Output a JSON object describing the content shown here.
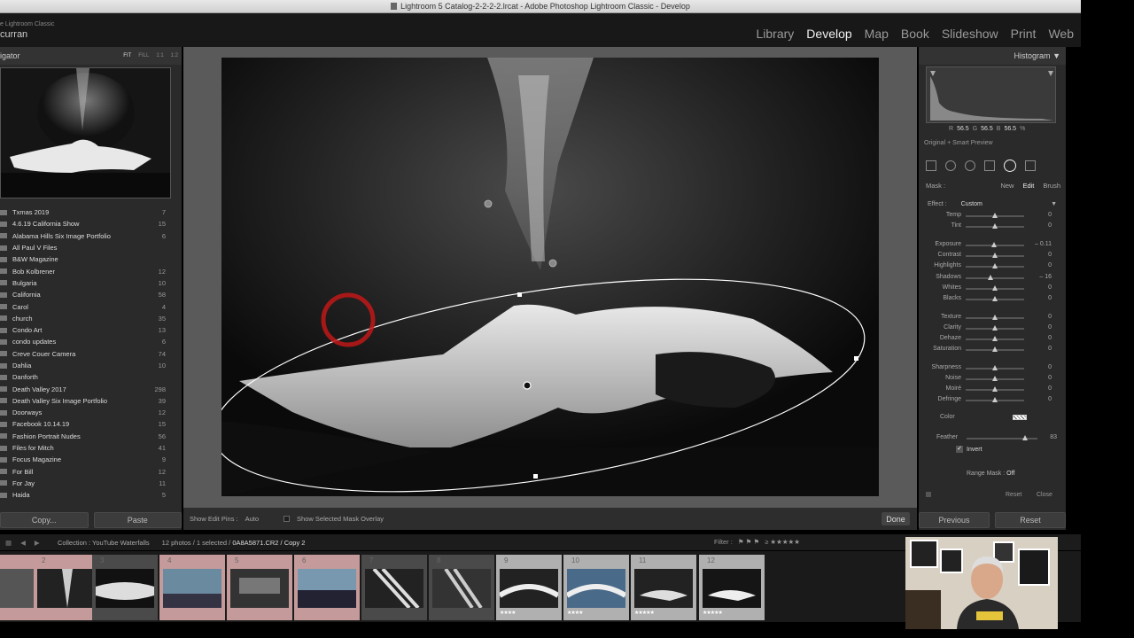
{
  "window": {
    "title": "Lightroom 5 Catalog-2-2-2-2.lrcat - Adobe Photoshop Lightroom Classic - Develop"
  },
  "brand": {
    "app": "e Lightroom Classic",
    "user": "curran"
  },
  "modules": [
    "Library",
    "Develop",
    "Map",
    "Book",
    "Slideshow",
    "Print",
    "Web"
  ],
  "navigator": {
    "title": "igator",
    "zoom": [
      "FIT",
      "FILL",
      "1:1",
      "1:2"
    ]
  },
  "collections": [
    {
      "name": "Txmas 2019",
      "count": "7"
    },
    {
      "name": "4.6.19 California Show",
      "count": "15"
    },
    {
      "name": "Alabama Hills Six Image Portfolio",
      "count": "6"
    },
    {
      "name": "All Paul V Files",
      "count": ""
    },
    {
      "name": "B&W Magazine",
      "count": ""
    },
    {
      "name": "Bob Kolbrener",
      "count": "12"
    },
    {
      "name": "Bulgaria",
      "count": "10"
    },
    {
      "name": "California",
      "count": "58"
    },
    {
      "name": "Carol",
      "count": "4"
    },
    {
      "name": "church",
      "count": "35"
    },
    {
      "name": "Condo Art",
      "count": "13"
    },
    {
      "name": "condo updates",
      "count": "6"
    },
    {
      "name": "Creve Couer Camera",
      "count": "74"
    },
    {
      "name": "Dahlia",
      "count": "10"
    },
    {
      "name": "Danforth",
      "count": ""
    },
    {
      "name": "Death Valley 2017",
      "count": "298"
    },
    {
      "name": "Death Valley Six Image Portfolio",
      "count": "39"
    },
    {
      "name": "Doorways",
      "count": "12"
    },
    {
      "name": "Facebook 10.14.19",
      "count": "15"
    },
    {
      "name": "Fashion Portrait Nudes",
      "count": "56"
    },
    {
      "name": "Files for Mitch",
      "count": "41"
    },
    {
      "name": "Focus Magazine",
      "count": "9"
    },
    {
      "name": "For Bill",
      "count": "12"
    },
    {
      "name": "For Jay",
      "count": "11"
    },
    {
      "name": "Haida",
      "count": "5"
    }
  ],
  "left_buttons": {
    "copy": "Copy...",
    "paste": "Paste"
  },
  "toolbar": {
    "show_pins_label": "Show Edit Pins :",
    "show_pins_value": "Auto",
    "overlay_label": "Show Selected Mask Overlay",
    "done": "Done"
  },
  "histogram": {
    "title": "Histogram",
    "r_label": "R",
    "r": "56.5",
    "g_label": "G",
    "g": "56.5",
    "b_label": "B",
    "b": "56.5",
    "pct": "%",
    "preview": "Original + Smart Preview"
  },
  "mask": {
    "label": "Mask :",
    "new": "New",
    "edit": "Edit",
    "brush": "Brush"
  },
  "effect": {
    "label": "Effect :",
    "value": "Custom"
  },
  "sliders": [
    {
      "label": "Temp",
      "value": "0",
      "pos": 0.5
    },
    {
      "label": "Tint",
      "value": "0",
      "pos": 0.5
    },
    {
      "label": "Exposure",
      "value": "– 0.11",
      "pos": 0.49
    },
    {
      "label": "Contrast",
      "value": "0",
      "pos": 0.5
    },
    {
      "label": "Highlights",
      "value": "0",
      "pos": 0.5
    },
    {
      "label": "Shadows",
      "value": "– 16",
      "pos": 0.43
    },
    {
      "label": "Whites",
      "value": "0",
      "pos": 0.5
    },
    {
      "label": "Blacks",
      "value": "0",
      "pos": 0.5
    },
    {
      "label": "Texture",
      "value": "0",
      "pos": 0.5
    },
    {
      "label": "Clarity",
      "value": "0",
      "pos": 0.5
    },
    {
      "label": "Dehaze",
      "value": "0",
      "pos": 0.5
    },
    {
      "label": "Saturation",
      "value": "0",
      "pos": 0.5
    },
    {
      "label": "Sharpness",
      "value": "0",
      "pos": 0.5
    },
    {
      "label": "Noise",
      "value": "0",
      "pos": 0.5
    },
    {
      "label": "Moiré",
      "value": "0",
      "pos": 0.5
    },
    {
      "label": "Defringe",
      "value": "0",
      "pos": 0.5
    }
  ],
  "color": {
    "label": "Color"
  },
  "feather": {
    "label": "Feather",
    "value": "83",
    "pos": 0.83
  },
  "invert": {
    "label": "Invert"
  },
  "range_mask": {
    "label": "Range Mask :",
    "value": "Off"
  },
  "panel_footer": {
    "reset": "Reset",
    "close": "Close"
  },
  "right_buttons": {
    "previous": "Previous",
    "reset": "Reset"
  },
  "filmstrip": {
    "collection": "Collection : YouTube Waterfalls",
    "count_pre": "12 photos / 1 selected /",
    "file": "0A8A5871.CR2 / Copy 2",
    "filter": "Filter :",
    "cells": [
      {
        "num": "",
        "stars": ""
      },
      {
        "num": "2",
        "stars": ""
      },
      {
        "num": "3",
        "stars": ""
      },
      {
        "num": "4",
        "stars": ""
      },
      {
        "num": "5",
        "stars": ""
      },
      {
        "num": "6",
        "stars": ""
      },
      {
        "num": "7",
        "stars": ""
      },
      {
        "num": "8",
        "stars": ""
      },
      {
        "num": "9",
        "stars": "★★★★"
      },
      {
        "num": "10",
        "stars": "★★★★"
      },
      {
        "num": "11",
        "stars": "★★★★★"
      },
      {
        "num": "12",
        "stars": "★★★★★"
      }
    ]
  }
}
